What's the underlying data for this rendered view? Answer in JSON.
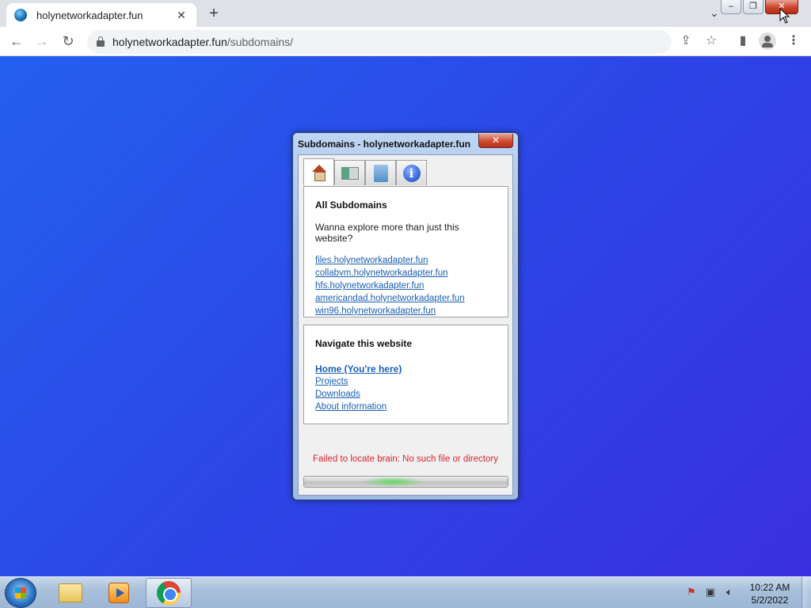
{
  "browser": {
    "tab_title": "holynetworkadapter.fun",
    "tab_close": "✕",
    "new_tab": "+",
    "tab_search": "⌄",
    "url_host": "holynetworkadapter.fun",
    "url_path": "/subdomains/",
    "window_buttons": {
      "minimize": "–",
      "restore": "❐",
      "close": "✕"
    }
  },
  "dialog": {
    "title": "Subdomains - holynetworkadapter.fun",
    "close": "✕",
    "tabs": [
      {
        "icon": "home-icon",
        "active": true
      },
      {
        "icon": "projects-icon",
        "active": false
      },
      {
        "icon": "downloads-icon",
        "active": false
      },
      {
        "icon": "info-icon",
        "active": false
      }
    ],
    "info_glyph": "i",
    "section1": {
      "heading": "All Subdomains",
      "text": "Wanna explore more than just this website?",
      "links": [
        "files.holynetworkadapter.fun",
        "collabvm.holynetworkadapter.fun",
        "hfs.holynetworkadapter.fun",
        "americandad.holynetworkadapter.fun",
        "win96.holynetworkadapter.fun"
      ]
    },
    "section2": {
      "heading": "Navigate this website",
      "links": [
        "Home (You're here)",
        "Projects",
        "Downloads",
        "About information"
      ]
    },
    "error": "Failed to locate brain: No such file or directory",
    "progress": "indeterminate"
  },
  "taskbar": {
    "apps": [
      {
        "name": "file-explorer",
        "active": false
      },
      {
        "name": "media-player",
        "active": false
      },
      {
        "name": "chrome",
        "active": true
      }
    ],
    "time": "10:22 AM",
    "date": "5/2/2022"
  },
  "colors": {
    "background": "#2a4fe6",
    "link": "#1a5fb4",
    "error": "#d9262e"
  }
}
